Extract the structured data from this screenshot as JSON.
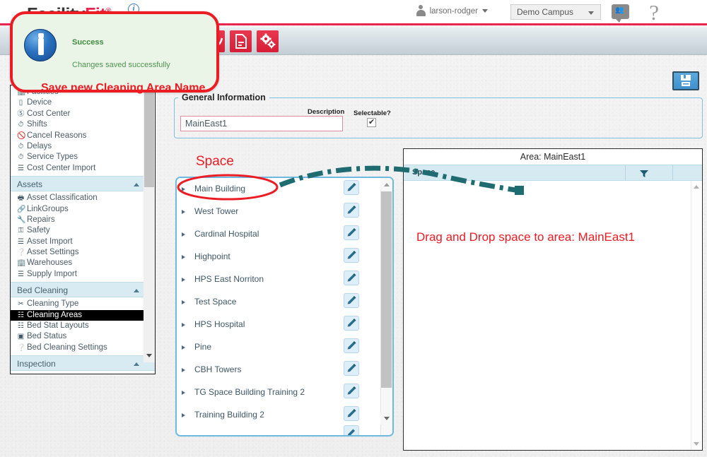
{
  "app": {
    "logo_main": "Facility",
    "logo_accent": "Fit",
    "logo_sup": "®",
    "info_icon_label": "i"
  },
  "header": {
    "user_name": "larson-rodger",
    "campus_value": "Demo Campus",
    "campus_options": [
      "Demo Campus"
    ],
    "people_icon": "people-icon",
    "help_icon": "?"
  },
  "toolbar": {
    "buttons": [
      {
        "name": "trend-tool",
        "icon": "wave-icon"
      },
      {
        "name": "document-tool",
        "icon": "document-icon"
      },
      {
        "name": "settings-tool",
        "icon": "gears-icon"
      }
    ]
  },
  "toast": {
    "title": "Success",
    "message": "Changes saved successfully",
    "annotation": "Save new Cleaning Area Name",
    "icon": "info-icon",
    "border_color": "#ec1c24",
    "background_color": "#eaf5e8",
    "title_color": "#3d8a3d"
  },
  "sidebar": {
    "top_items": [
      {
        "label": "Facilities",
        "icon": "building-icon"
      },
      {
        "label": "Device",
        "icon": "device-icon"
      },
      {
        "label": "Cost Center",
        "icon": "dollar-icon"
      },
      {
        "label": "Shifts",
        "icon": "clock-icon"
      },
      {
        "label": "Cancel Reasons",
        "icon": "no-entry-icon"
      },
      {
        "label": "Delays",
        "icon": "clock-icon"
      },
      {
        "label": "Service Types",
        "icon": "clock-icon"
      },
      {
        "label": "Cost Center Import",
        "icon": "stack-icon"
      }
    ],
    "sections": [
      {
        "title": "Assets",
        "collapse_icon": "chevron-up-icon",
        "items": [
          {
            "label": "Asset Classification",
            "icon": "printer-icon"
          },
          {
            "label": "LinkGroups",
            "icon": "link-icon"
          },
          {
            "label": "Repairs",
            "icon": "wrench-icon"
          },
          {
            "label": "Safety",
            "icon": "shield-icon"
          },
          {
            "label": "Asset Import",
            "icon": "stack-icon"
          },
          {
            "label": "Asset Settings",
            "icon": "question-icon"
          },
          {
            "label": "Warehouses",
            "icon": "building-icon"
          },
          {
            "label": "Supply Import",
            "icon": "stack-icon"
          }
        ]
      },
      {
        "title": "Bed Cleaning",
        "collapse_icon": "chevron-up-icon",
        "items": [
          {
            "label": "Cleaning Type",
            "icon": "bed-icon",
            "selected": false
          },
          {
            "label": "Cleaning Areas",
            "icon": "sitemap-icon",
            "selected": true
          },
          {
            "label": "Bed Stat Layouts",
            "icon": "sitemap-icon",
            "selected": false
          },
          {
            "label": "Bed Status",
            "icon": "list-icon",
            "selected": false
          },
          {
            "label": "Bed Cleaning Settings",
            "icon": "question-icon",
            "selected": false
          }
        ]
      },
      {
        "title": "Inspection",
        "collapse_icon": "chevron-up-icon",
        "items": []
      }
    ]
  },
  "general_information": {
    "legend": "General Information",
    "description_label": "Description",
    "description_value": "MainEast1",
    "selectable_label": "Selectable?",
    "selectable_checked": true
  },
  "space_panel": {
    "heading": "Space",
    "heading_color": "#ec1c24",
    "highlighted_item": "Main Building",
    "rows": [
      {
        "label": "Main Building",
        "edit_icon": "pencil-icon"
      },
      {
        "label": "West Tower",
        "edit_icon": "pencil-icon"
      },
      {
        "label": "Cardinal Hospital",
        "edit_icon": "pencil-icon"
      },
      {
        "label": "Highpoint",
        "edit_icon": "pencil-icon"
      },
      {
        "label": "HPS East Norriton",
        "edit_icon": "pencil-icon"
      },
      {
        "label": "Test Space",
        "edit_icon": "pencil-icon"
      },
      {
        "label": "HPS Hospital",
        "edit_icon": "pencil-icon"
      },
      {
        "label": "Pine",
        "edit_icon": "pencil-icon"
      },
      {
        "label": "CBH Towers",
        "edit_icon": "pencil-icon"
      },
      {
        "label": "TG Space Building Training 2",
        "edit_icon": "pencil-icon"
      },
      {
        "label": "Training Building 2",
        "edit_icon": "pencil-icon"
      }
    ]
  },
  "area_panel": {
    "title": "Area: MainEast1",
    "column_header": "Space",
    "filter_icon": "filter-icon",
    "note": "Drag and Drop space to area: MainEast1",
    "note_color": "#ec1c24",
    "rows": []
  },
  "save_button": {
    "name": "save-button",
    "icon": "floppy-disk-icon",
    "color": "#3f90cd"
  },
  "annotations": {
    "ellipse_target": "Main Building",
    "arrow_from": "Main Building",
    "arrow_to": "Area: MainEast1 grid",
    "stroke_color": "#1e6b70"
  }
}
